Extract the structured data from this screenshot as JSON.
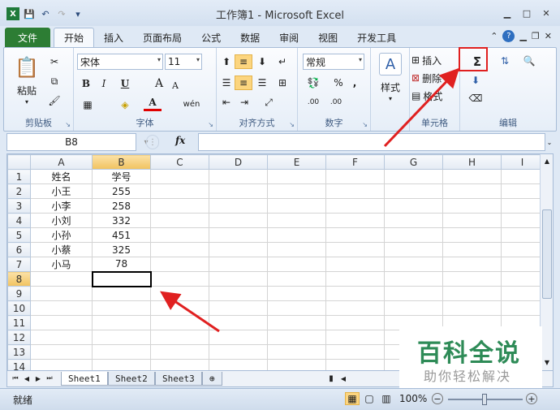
{
  "window": {
    "title": "工作簿1 - Microsoft Excel"
  },
  "tabs": {
    "file": "文件",
    "items": [
      "开始",
      "插入",
      "页面布局",
      "公式",
      "数据",
      "审阅",
      "视图",
      "开发工具"
    ]
  },
  "ribbon": {
    "clipboard": {
      "paste": "粘贴",
      "label": "剪贴板"
    },
    "font": {
      "name": "宋体",
      "size": "11",
      "bold": "B",
      "italic": "I",
      "underline": "U",
      "grow": "A",
      "shrink": "A",
      "label": "字体",
      "phonetic": "wén",
      "fontcolor": "A"
    },
    "alignment": {
      "label": "对齐方式"
    },
    "number": {
      "format": "常规",
      "percent": "%",
      "comma": ",",
      "label": "数字",
      "dec_inc": ".00",
      "dec_dec": ".00"
    },
    "styles": {
      "label": "样式"
    },
    "cells": {
      "insert": "插入",
      "delete": "删除",
      "format": "格式",
      "label": "单元格"
    },
    "editing": {
      "sum": "Σ",
      "label": "编辑"
    }
  },
  "formula": {
    "namebox": "B8",
    "fx": "fx",
    "value": ""
  },
  "sheet": {
    "columns": [
      "A",
      "B",
      "C",
      "D",
      "E",
      "F",
      "G",
      "H",
      "I"
    ],
    "rows": [
      "1",
      "2",
      "3",
      "4",
      "5",
      "6",
      "7",
      "8",
      "9",
      "10",
      "11",
      "12",
      "13",
      "14"
    ],
    "data": [
      [
        "姓名",
        "学号"
      ],
      [
        "小王",
        "255"
      ],
      [
        "小李",
        "258"
      ],
      [
        "小刘",
        "332"
      ],
      [
        "小孙",
        "451"
      ],
      [
        "小蔡",
        "325"
      ],
      [
        "小马",
        "78"
      ]
    ]
  },
  "sheettabs": [
    "Sheet1",
    "Sheet2",
    "Sheet3"
  ],
  "status": {
    "ready": "就绪",
    "zoom": "100%",
    "minus": "−",
    "plus": "+"
  },
  "watermark": {
    "line1": "百科全说",
    "line2": "助你轻松解决"
  }
}
